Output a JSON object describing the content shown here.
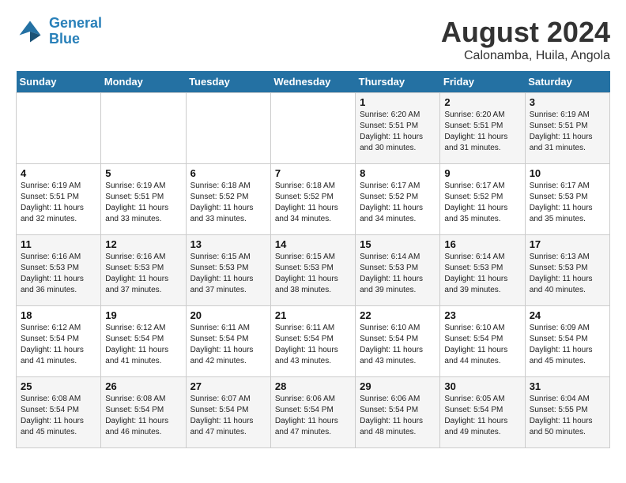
{
  "header": {
    "logo_line1": "General",
    "logo_line2": "Blue",
    "month_title": "August 2024",
    "location": "Calonamba, Huila, Angola"
  },
  "weekdays": [
    "Sunday",
    "Monday",
    "Tuesday",
    "Wednesday",
    "Thursday",
    "Friday",
    "Saturday"
  ],
  "weeks": [
    [
      {
        "day": "",
        "content": ""
      },
      {
        "day": "",
        "content": ""
      },
      {
        "day": "",
        "content": ""
      },
      {
        "day": "",
        "content": ""
      },
      {
        "day": "1",
        "content": "Sunrise: 6:20 AM\nSunset: 5:51 PM\nDaylight: 11 hours\nand 30 minutes."
      },
      {
        "day": "2",
        "content": "Sunrise: 6:20 AM\nSunset: 5:51 PM\nDaylight: 11 hours\nand 31 minutes."
      },
      {
        "day": "3",
        "content": "Sunrise: 6:19 AM\nSunset: 5:51 PM\nDaylight: 11 hours\nand 31 minutes."
      }
    ],
    [
      {
        "day": "4",
        "content": "Sunrise: 6:19 AM\nSunset: 5:51 PM\nDaylight: 11 hours\nand 32 minutes."
      },
      {
        "day": "5",
        "content": "Sunrise: 6:19 AM\nSunset: 5:51 PM\nDaylight: 11 hours\nand 33 minutes."
      },
      {
        "day": "6",
        "content": "Sunrise: 6:18 AM\nSunset: 5:52 PM\nDaylight: 11 hours\nand 33 minutes."
      },
      {
        "day": "7",
        "content": "Sunrise: 6:18 AM\nSunset: 5:52 PM\nDaylight: 11 hours\nand 34 minutes."
      },
      {
        "day": "8",
        "content": "Sunrise: 6:17 AM\nSunset: 5:52 PM\nDaylight: 11 hours\nand 34 minutes."
      },
      {
        "day": "9",
        "content": "Sunrise: 6:17 AM\nSunset: 5:52 PM\nDaylight: 11 hours\nand 35 minutes."
      },
      {
        "day": "10",
        "content": "Sunrise: 6:17 AM\nSunset: 5:53 PM\nDaylight: 11 hours\nand 35 minutes."
      }
    ],
    [
      {
        "day": "11",
        "content": "Sunrise: 6:16 AM\nSunset: 5:53 PM\nDaylight: 11 hours\nand 36 minutes."
      },
      {
        "day": "12",
        "content": "Sunrise: 6:16 AM\nSunset: 5:53 PM\nDaylight: 11 hours\nand 37 minutes."
      },
      {
        "day": "13",
        "content": "Sunrise: 6:15 AM\nSunset: 5:53 PM\nDaylight: 11 hours\nand 37 minutes."
      },
      {
        "day": "14",
        "content": "Sunrise: 6:15 AM\nSunset: 5:53 PM\nDaylight: 11 hours\nand 38 minutes."
      },
      {
        "day": "15",
        "content": "Sunrise: 6:14 AM\nSunset: 5:53 PM\nDaylight: 11 hours\nand 39 minutes."
      },
      {
        "day": "16",
        "content": "Sunrise: 6:14 AM\nSunset: 5:53 PM\nDaylight: 11 hours\nand 39 minutes."
      },
      {
        "day": "17",
        "content": "Sunrise: 6:13 AM\nSunset: 5:53 PM\nDaylight: 11 hours\nand 40 minutes."
      }
    ],
    [
      {
        "day": "18",
        "content": "Sunrise: 6:12 AM\nSunset: 5:54 PM\nDaylight: 11 hours\nand 41 minutes."
      },
      {
        "day": "19",
        "content": "Sunrise: 6:12 AM\nSunset: 5:54 PM\nDaylight: 11 hours\nand 41 minutes."
      },
      {
        "day": "20",
        "content": "Sunrise: 6:11 AM\nSunset: 5:54 PM\nDaylight: 11 hours\nand 42 minutes."
      },
      {
        "day": "21",
        "content": "Sunrise: 6:11 AM\nSunset: 5:54 PM\nDaylight: 11 hours\nand 43 minutes."
      },
      {
        "day": "22",
        "content": "Sunrise: 6:10 AM\nSunset: 5:54 PM\nDaylight: 11 hours\nand 43 minutes."
      },
      {
        "day": "23",
        "content": "Sunrise: 6:10 AM\nSunset: 5:54 PM\nDaylight: 11 hours\nand 44 minutes."
      },
      {
        "day": "24",
        "content": "Sunrise: 6:09 AM\nSunset: 5:54 PM\nDaylight: 11 hours\nand 45 minutes."
      }
    ],
    [
      {
        "day": "25",
        "content": "Sunrise: 6:08 AM\nSunset: 5:54 PM\nDaylight: 11 hours\nand 45 minutes."
      },
      {
        "day": "26",
        "content": "Sunrise: 6:08 AM\nSunset: 5:54 PM\nDaylight: 11 hours\nand 46 minutes."
      },
      {
        "day": "27",
        "content": "Sunrise: 6:07 AM\nSunset: 5:54 PM\nDaylight: 11 hours\nand 47 minutes."
      },
      {
        "day": "28",
        "content": "Sunrise: 6:06 AM\nSunset: 5:54 PM\nDaylight: 11 hours\nand 47 minutes."
      },
      {
        "day": "29",
        "content": "Sunrise: 6:06 AM\nSunset: 5:54 PM\nDaylight: 11 hours\nand 48 minutes."
      },
      {
        "day": "30",
        "content": "Sunrise: 6:05 AM\nSunset: 5:54 PM\nDaylight: 11 hours\nand 49 minutes."
      },
      {
        "day": "31",
        "content": "Sunrise: 6:04 AM\nSunset: 5:55 PM\nDaylight: 11 hours\nand 50 minutes."
      }
    ]
  ]
}
